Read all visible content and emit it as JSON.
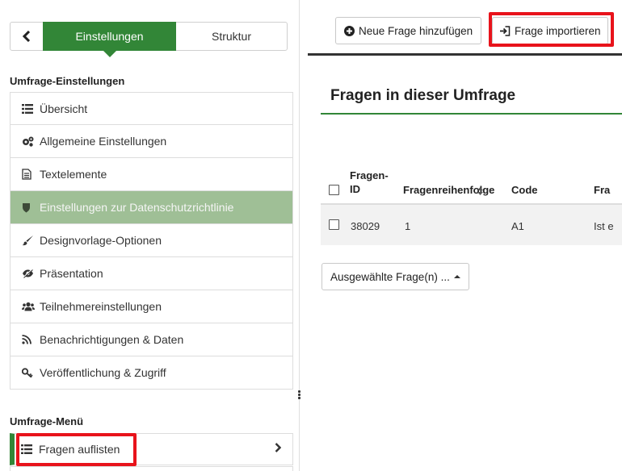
{
  "sidebar": {
    "topnav": {
      "back_icon": "chevron-left-icon",
      "tab_settings": "Einstellungen",
      "tab_structure": "Struktur"
    },
    "section1_title": "Umfrage-Einstellungen",
    "items": [
      {
        "label": "Übersicht",
        "icon": "list-icon"
      },
      {
        "label": "Allgemeine Einstellungen",
        "icon": "gears-icon"
      },
      {
        "label": "Textelemente",
        "icon": "file-text-icon"
      },
      {
        "label": "Einstellungen zur Datenschutzrichtlinie",
        "icon": "shield-icon"
      },
      {
        "label": "Designvorlage-Optionen",
        "icon": "paint-brush-icon"
      },
      {
        "label": "Präsentation",
        "icon": "eye-slash-icon"
      },
      {
        "label": "Teilnehmereinstellungen",
        "icon": "users-icon"
      },
      {
        "label": "Benachrichtigungen & Daten",
        "icon": "rss-icon"
      },
      {
        "label": "Veröffentlichung & Zugriff",
        "icon": "key-icon"
      }
    ],
    "section2_title": "Umfrage-Menü",
    "menu2_items": [
      {
        "label": "Fragen auflisten",
        "icon": "list-icon"
      }
    ]
  },
  "toolbar": {
    "add_question": "Neue Frage hinzufügen",
    "import_question": "Frage importieren"
  },
  "main": {
    "title": "Fragen in dieser Umfrage",
    "table": {
      "headers": [
        "Fragen-\nID",
        "Fragenreihenfolge",
        "Code",
        "Fra"
      ],
      "rows": [
        {
          "id": "38029",
          "order": "1",
          "code": "A1",
          "text": "Ist e"
        }
      ]
    },
    "bulk_button": "Ausgewählte Frage(n) ..."
  },
  "colors": {
    "accent_green": "#328637",
    "active_item_bg": "#9fbf96",
    "highlight_red": "#e8131b"
  }
}
